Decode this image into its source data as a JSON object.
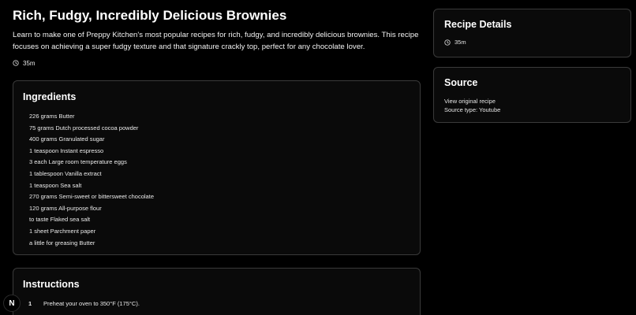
{
  "recipe": {
    "title": "Rich, Fudgy, Incredibly Delicious Brownies",
    "description": "Learn to make one of Preppy Kitchen's most popular recipes for rich, fudgy, and incredibly delicious brownies. This recipe focuses on achieving a super fudgy texture and that signature crackly top, perfect for any chocolate lover.",
    "time": "35m",
    "time_icon": "clock-icon"
  },
  "ingredients": {
    "heading": "Ingredients",
    "items": [
      "226 grams Butter",
      "75 grams Dutch processed cocoa powder",
      "400 grams Granulated sugar",
      "1 teaspoon Instant espresso",
      "3 each Large room temperature eggs",
      "1 tablespoon Vanilla extract",
      "1 teaspoon Sea salt",
      "270 grams Semi-sweet or bittersweet chocolate",
      "120 grams All-purpose flour",
      "to taste Flaked sea salt",
      "1 sheet Parchment paper",
      "a little for greasing Butter"
    ]
  },
  "instructions": {
    "heading": "Instructions",
    "steps": [
      {
        "number": "1",
        "text": "Preheat your oven to 350°F (175°C)."
      }
    ]
  },
  "details": {
    "heading": "Recipe Details",
    "time": "35m"
  },
  "source": {
    "heading": "Source",
    "link_text": "View original recipe",
    "type_text": "Source type: Youtube"
  },
  "badge": {
    "letter": "N"
  }
}
